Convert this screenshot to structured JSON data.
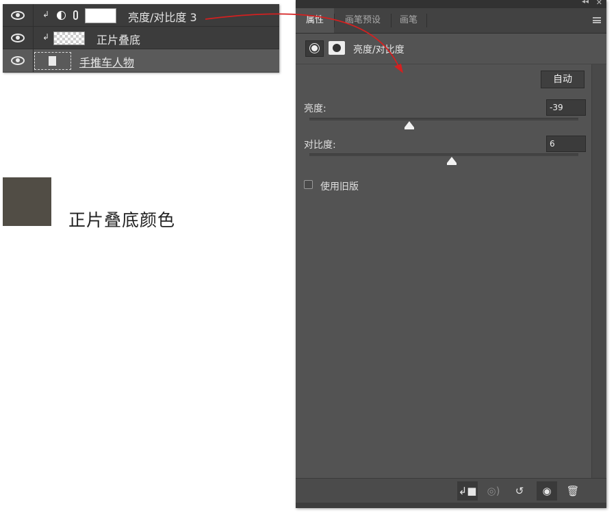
{
  "layers": {
    "rows": [
      {
        "name": "亮度/对比度 3"
      },
      {
        "name": "正片叠底"
      },
      {
        "name": "手推车人物"
      }
    ]
  },
  "swatch": {
    "color": "#514d45",
    "caption": "正片叠底颜色"
  },
  "properties": {
    "tabs": [
      {
        "label": "属性"
      },
      {
        "label": "画笔预设"
      },
      {
        "label": "画笔"
      }
    ],
    "header_title": "亮度/对比度",
    "auto_label": "自动",
    "brightness": {
      "label": "亮度:",
      "value": "-39"
    },
    "contrast": {
      "label": "对比度:",
      "value": "6"
    },
    "legacy_label": "使用旧版",
    "legacy_checked": false
  },
  "colors": {
    "annotation_arrow": "#d42020",
    "panel_bg": "#535353",
    "layers_bg": "#3c3c3c"
  },
  "icons": {
    "footer": [
      "clip-to-layer-icon",
      "view-previous-state-icon",
      "reset-icon",
      "visibility-icon",
      "delete-icon"
    ]
  }
}
